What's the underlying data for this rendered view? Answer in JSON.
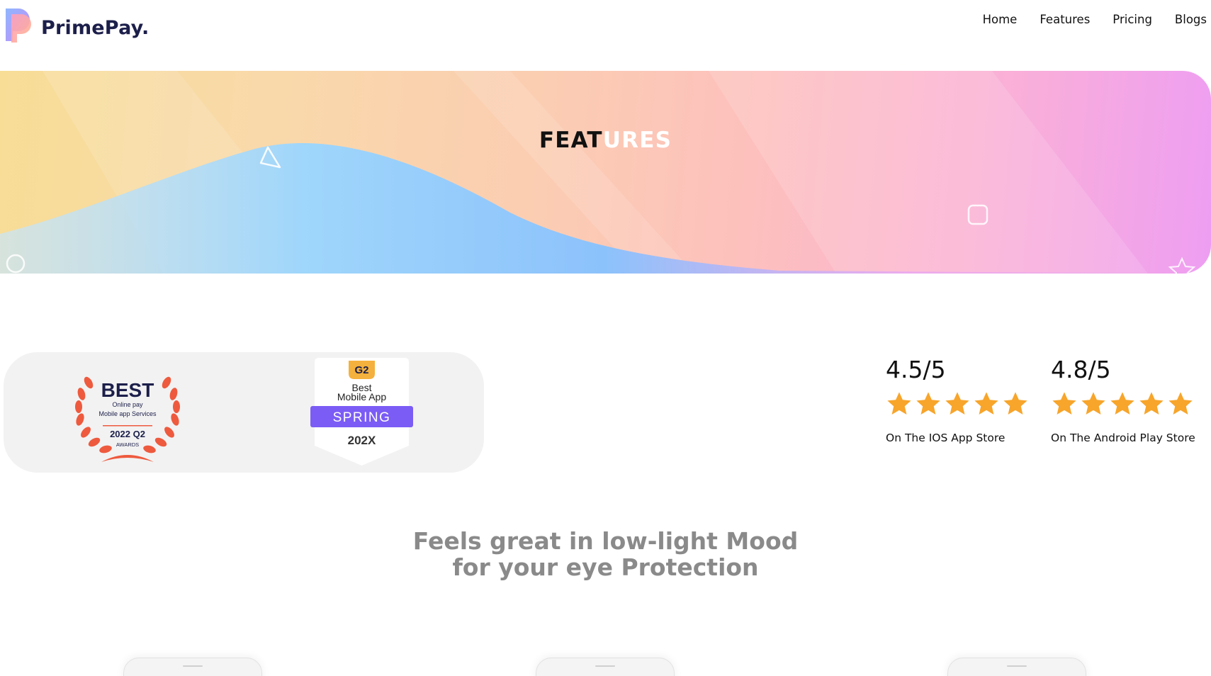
{
  "brand": {
    "name": "PrimePay."
  },
  "nav": [
    {
      "label": "Home"
    },
    {
      "label": "Features"
    },
    {
      "label": "Pricing"
    },
    {
      "label": "Blogs"
    }
  ],
  "hero": {
    "title_dark": "FEAT",
    "title_light": "URES"
  },
  "awards": {
    "best": {
      "headline": "BEST",
      "line1": "Online pay",
      "line2": "Mobile app Services",
      "period": "2022 Q2",
      "footer": "AWARDS",
      "color": "#ee5a3e"
    },
    "g2": {
      "logo": "G2",
      "line1": "Best",
      "line2": "Mobile App",
      "season": "SPRING",
      "year": "202X",
      "accent": "#7b5cf5"
    }
  },
  "ratings": [
    {
      "score": "4.5/5",
      "stars": 5,
      "label": "On The IOS App Store"
    },
    {
      "score": "4.8/5",
      "stars": 5,
      "label": "On The Android Play Store"
    }
  ],
  "section": {
    "line1": "Feels great in low-light Mood",
    "line2": "for your eye Protection"
  },
  "colors": {
    "star": "#f7a52b",
    "brand_text": "#1c1f4a"
  }
}
